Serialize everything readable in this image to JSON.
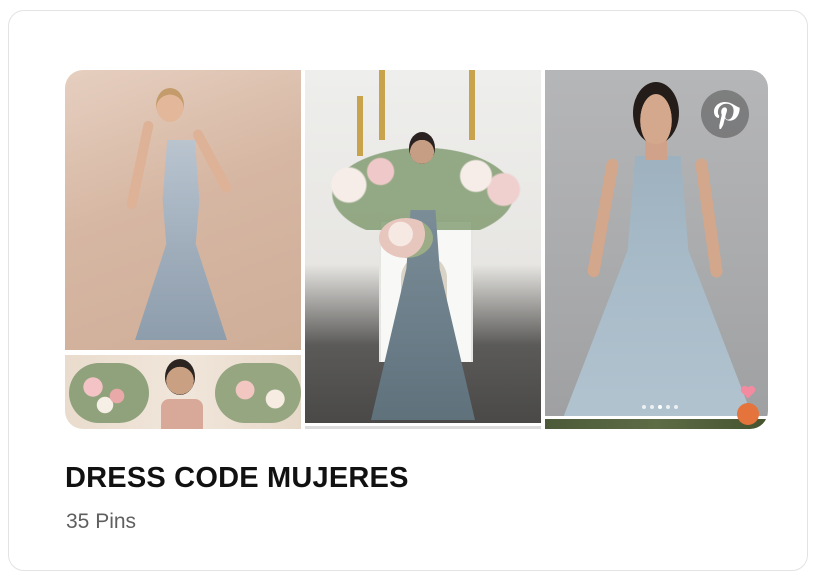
{
  "board": {
    "title": "DRESS CODE MUJERES",
    "pin_count": "35 Pins"
  },
  "cover": {
    "images": [
      {
        "name": "photo-satin-slip-dress"
      },
      {
        "name": "photo-floral-backdrop"
      },
      {
        "name": "photo-tulle-dress-fireplace"
      },
      {
        "name": "photo-tulle-gown-grey"
      }
    ],
    "overlay_icon": "pinterest-logo-icon",
    "carousel_dots": 5,
    "carousel_active_index": 2
  },
  "colors": {
    "card_border": "#e3e3e3",
    "title_text": "#111111",
    "count_text": "#5f5f5f",
    "badge": "#e5733c",
    "heart": "#f28aa0"
  }
}
